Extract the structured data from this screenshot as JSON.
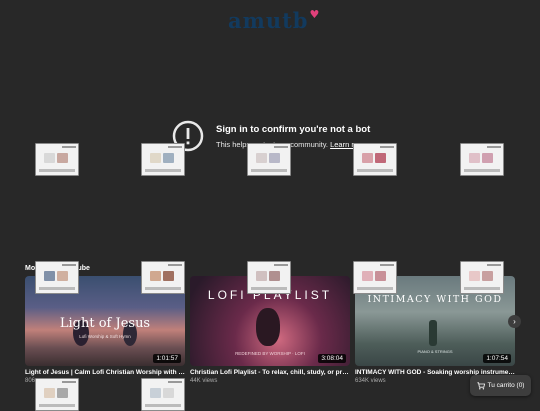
{
  "header": {
    "logo_text": "amutb",
    "logo_heart": "♥"
  },
  "notice": {
    "title": "Sign in to confirm you're not a bot",
    "text": "This helps protect our community.",
    "link": "Learn more"
  },
  "section": {
    "title": "More from YouTube"
  },
  "videos": [
    {
      "thumb_title": "Light of Jesus",
      "thumb_subtitle": "Lofi Worship & Soft Hymn",
      "duration": "1:01:57",
      "title": "Light of Jesus | Calm Lofi Christian Worship with t...",
      "views": "806"
    },
    {
      "thumb_title": "LOFI PLAYLIST",
      "thumb_subtitle": "REDEFINED BY WORSHIP · LOFI",
      "duration": "3:08:04",
      "title": "Christian Lofi Playlist - To relax, chill, study, or pray ...",
      "views": "44K views"
    },
    {
      "thumb_title": "INTIMACY WITH GOD",
      "thumb_subtitle": "PIANO & STRINGS",
      "duration": "1:07:54",
      "title": "INTIMACY WITH GOD - Soaking worship instrumen...",
      "views": "634K views"
    }
  ],
  "cart": {
    "icon": "cart-icon",
    "label": "Tu carrito (0)"
  },
  "colors": {
    "background": "#282828",
    "logo": "#123a5e",
    "heart": "#e0407a"
  }
}
